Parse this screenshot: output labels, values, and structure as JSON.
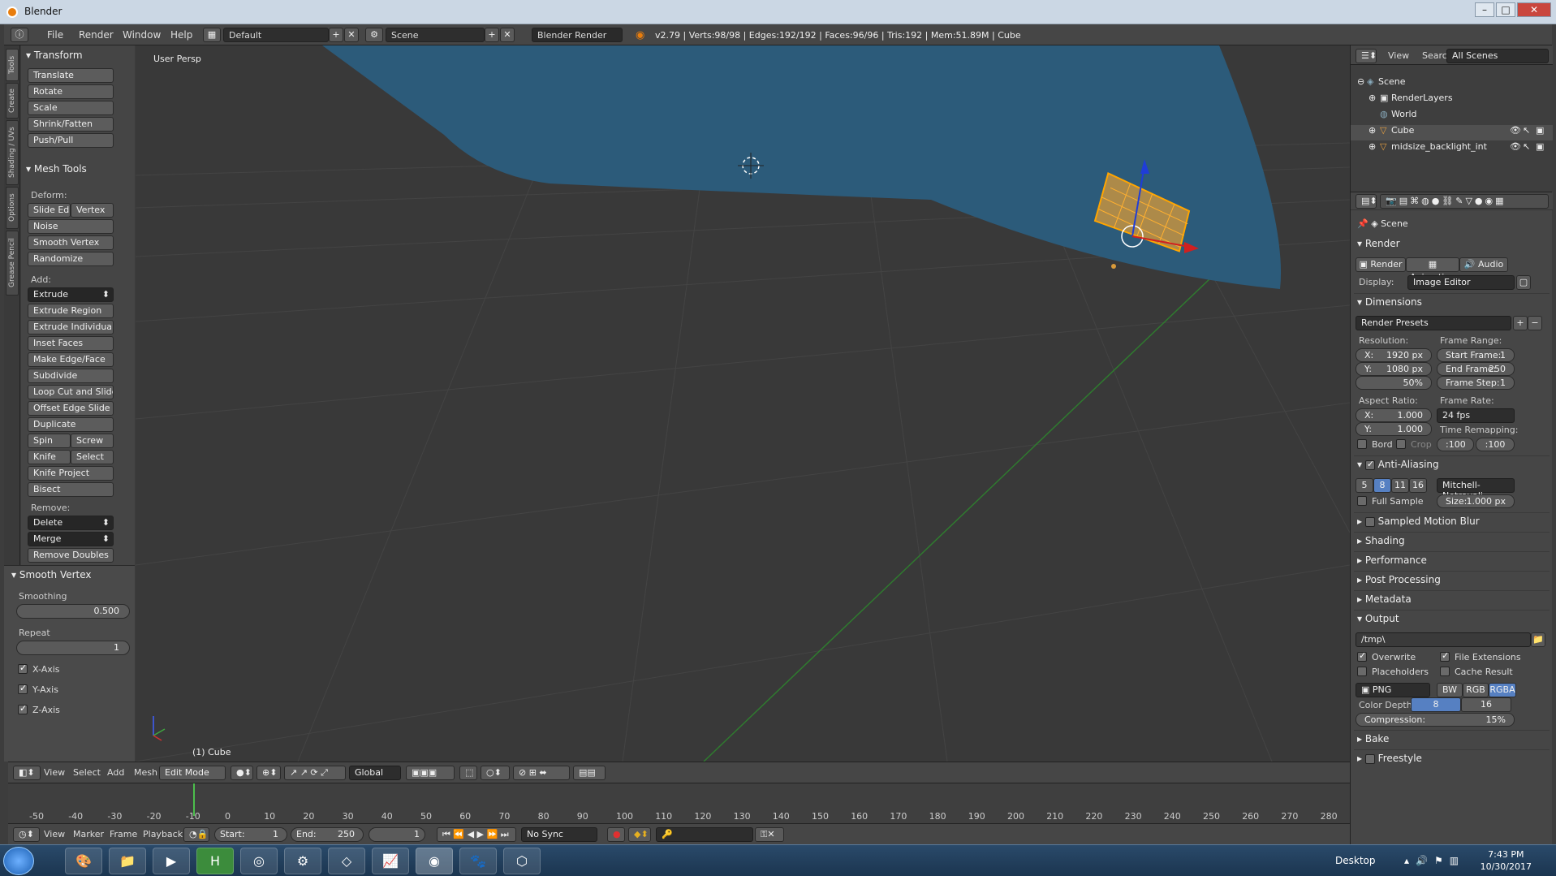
{
  "window": {
    "title": "Blender"
  },
  "menubar": {
    "items": [
      "File",
      "Render",
      "Window",
      "Help"
    ],
    "layout": "Default",
    "scene": "Scene",
    "engine": "Blender Render",
    "stats": "v2.79 | Verts:98/98 | Edges:192/192 | Faces:96/96 | Tris:192 | Mem:51.89M | Cube"
  },
  "tabs": [
    "Tools",
    "Create",
    "Shading / UVs",
    "Options",
    "Grease Pencil"
  ],
  "toolshelf": {
    "transform_title": "Transform",
    "transform_buttons": [
      "Translate",
      "Rotate",
      "Scale",
      "Shrink/Fatten",
      "Push/Pull"
    ],
    "meshtools_title": "Mesh Tools",
    "deform_label": "Deform:",
    "slide_edge": "Slide Ed",
    "vertex": "Vertex",
    "deform_buttons": [
      "Noise",
      "Smooth Vertex",
      "Randomize"
    ],
    "add_label": "Add:",
    "extrude": "Extrude",
    "add_buttons": [
      "Extrude Region",
      "Extrude Individual",
      "Inset Faces",
      "Make Edge/Face",
      "Subdivide",
      "Loop Cut and Slide",
      "Offset Edge Slide",
      "Duplicate"
    ],
    "spin": "Spin",
    "screw": "Screw",
    "knife": "Knife",
    "select": "Select",
    "knife_project": "Knife Project",
    "bisect": "Bisect",
    "remove_label": "Remove:",
    "delete": "Delete",
    "merge": "Merge",
    "remove_doubles": "Remove Doubles",
    "op_title": "Smooth Vertex",
    "smoothing_label": "Smoothing",
    "smoothing_value": "0.500",
    "repeat_label": "Repeat",
    "repeat_value": "1",
    "xaxis": "X-Axis",
    "yaxis": "Y-Axis",
    "zaxis": "Z-Axis"
  },
  "viewport": {
    "label": "User Persp",
    "object": "(1) Cube"
  },
  "vpheader": {
    "menus": [
      "View",
      "Select",
      "Add",
      "Mesh"
    ],
    "mode": "Edit Mode",
    "orientation": "Global"
  },
  "timeline": {
    "ticks": [
      "-50",
      "-40",
      "-30",
      "-20",
      "-10",
      "0",
      "10",
      "20",
      "30",
      "40",
      "50",
      "60",
      "70",
      "80",
      "90",
      "100",
      "110",
      "120",
      "130",
      "140",
      "150",
      "160",
      "170",
      "180",
      "190",
      "200",
      "210",
      "220",
      "230",
      "240",
      "250",
      "260",
      "270",
      "280"
    ],
    "menus": [
      "View",
      "Marker",
      "Frame",
      "Playback"
    ],
    "start_label": "Start:",
    "start": "1",
    "end_label": "End:",
    "end": "250",
    "current": "1",
    "sync": "No Sync"
  },
  "outliner": {
    "menus": [
      "View",
      "Search"
    ],
    "filter": "All Scenes",
    "rows": [
      "Scene",
      "RenderLayers",
      "World",
      "Cube",
      "midsize_backlight_int"
    ]
  },
  "properties": {
    "context": "Scene",
    "render_title": "Render",
    "render_btn": "Render",
    "animation_btn": "Animation",
    "audio_btn": "Audio",
    "display_label": "Display:",
    "display": "Image Editor",
    "dimensions_title": "Dimensions",
    "presets": "Render Presets",
    "resolution_label": "Resolution:",
    "res_x_label": "X:",
    "res_x": "1920 px",
    "res_y_label": "Y:",
    "res_y": "1080 px",
    "res_pct": "50%",
    "framerange_label": "Frame Range:",
    "start_frame_label": "Start Frame:",
    "start_frame": "1",
    "end_frame_label": "End Frame:",
    "end_frame": "250",
    "frame_step_label": "Frame Step:",
    "frame_step": "1",
    "aspect_label": "Aspect Ratio:",
    "asp_x_label": "X:",
    "asp_x": "1.000",
    "asp_y_label": "Y:",
    "asp_y": "1.000",
    "framerate_label": "Frame Rate:",
    "framerate": "24 fps",
    "time_remap_label": "Time Remapping:",
    "remap_old": ":100",
    "remap_new": ":100",
    "bord": "Bord",
    "crop": "Crop",
    "aa_title": "Anti-Aliasing",
    "aa_samples": [
      "5",
      "8",
      "11",
      "16"
    ],
    "aa_filter": "Mitchell-Netravali",
    "full_sample": "Full Sample",
    "size_label": "Size:",
    "size": "1.000 px",
    "collapsed": [
      "Sampled Motion Blur",
      "Shading",
      "Performance",
      "Post Processing",
      "Metadata"
    ],
    "output_title": "Output",
    "output_path": "/tmp\\",
    "overwrite": "Overwrite",
    "file_ext": "File Extensions",
    "placeholders": "Placeholders",
    "cache": "Cache Result",
    "format": "PNG",
    "bw": "BW",
    "rgb": "RGB",
    "rgba": "RGBA",
    "depth_label": "Color Depth:",
    "depth_8": "8",
    "depth_16": "16",
    "compression_label": "Compression:",
    "compression": "15%",
    "bake": "Bake",
    "freestyle": "Freestyle"
  },
  "taskbar": {
    "desktop": "Desktop",
    "time": "7:43 PM",
    "date": "10/30/2017"
  }
}
